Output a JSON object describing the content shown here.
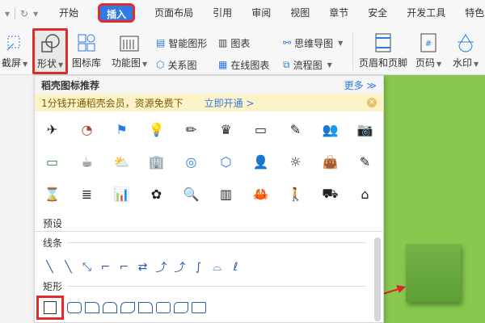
{
  "menubar": {
    "quick_access": [
      "▾",
      "↻",
      "▾"
    ],
    "tabs": [
      "开始",
      "插入",
      "页面布局",
      "引用",
      "审阅",
      "视图",
      "章节",
      "安全",
      "开发工具",
      "特色"
    ],
    "active_tab": "插入"
  },
  "toolbar": {
    "screenshot": "截屏",
    "shape": "形状",
    "icon_library": "图标库",
    "function_chart": "功能图",
    "smart_shape": "智能图形",
    "chart": "图表",
    "mind_map": "思维导图",
    "relation_chart": "关系图",
    "online_chart": "在线图表",
    "flowchart": "流程图",
    "header_footer": "页眉和页脚",
    "page_number": "页码",
    "watermark": "水印"
  },
  "panel": {
    "title": "稻壳图标推荐",
    "more": "更多 ≫",
    "banner_text": "1分钱开通稻壳会员，资源免费下",
    "banner_link": "立即开通 >",
    "icons": [
      "✈",
      "◔",
      "⚑",
      "💡",
      "✏",
      "♛",
      "▭",
      "✎",
      "👥",
      "📷",
      "▭",
      "☕",
      "⛅",
      "🏢",
      "◎",
      "⬡",
      "👤",
      "☼",
      "👜",
      "✎",
      "⌛",
      "≣",
      "📊",
      "✿",
      "🔍",
      "▥",
      "🦀",
      "🚶",
      "⛟",
      "⌂"
    ],
    "preset_label": "预设",
    "lines_label": "线条",
    "lines": [
      "╲",
      "╲",
      "⤡",
      "⌐",
      "⌐",
      "⇄",
      "⤴",
      "⤴",
      "∫",
      "⌓",
      "ℓ"
    ],
    "rect_label": "矩形"
  }
}
